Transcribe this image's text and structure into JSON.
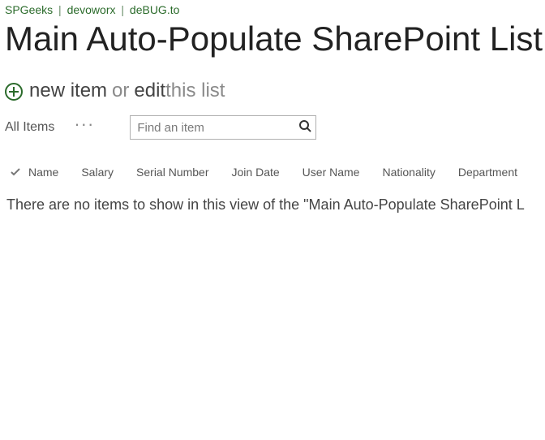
{
  "breadcrumb": {
    "items": [
      "SPGeeks",
      "devoworx",
      "deBUG.to"
    ],
    "sep": "|"
  },
  "title": "Main Auto-Populate SharePoint List",
  "actions": {
    "new_item": "new item",
    "or": "or",
    "edit": "edit",
    "this_list": " this list"
  },
  "toolbar": {
    "view": "All Items",
    "ellipsis": "···",
    "search_placeholder": "Find an item"
  },
  "columns": [
    "Name",
    "Salary",
    "Serial Number",
    "Join Date",
    "User Name",
    "Nationality",
    "Department"
  ],
  "empty_message": "There are no items to show in this view of the \"Main Auto-Populate SharePoint L"
}
